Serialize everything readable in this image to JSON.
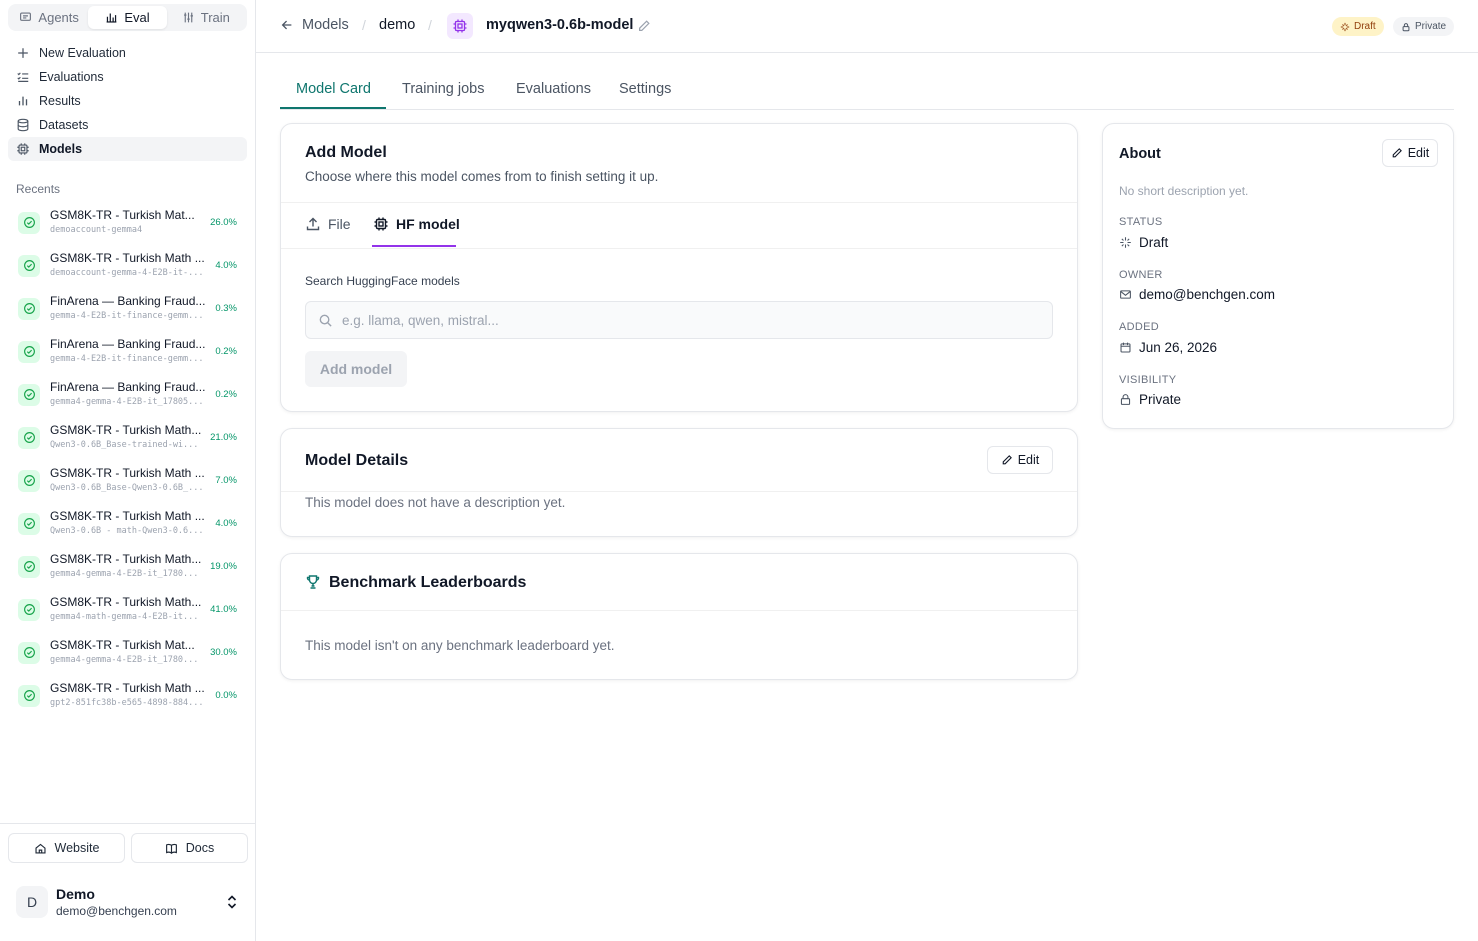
{
  "sidebar": {
    "modes": [
      {
        "label": "Agents",
        "icon": "chat-icon"
      },
      {
        "label": "Eval",
        "icon": "chart-icon"
      },
      {
        "label": "Train",
        "icon": "sliders-icon"
      }
    ],
    "nav": [
      {
        "label": "New Evaluation",
        "icon": "plus-icon"
      },
      {
        "label": "Evaluations",
        "icon": "list-check-icon"
      },
      {
        "label": "Results",
        "icon": "bar-chart-icon"
      },
      {
        "label": "Datasets",
        "icon": "database-icon"
      },
      {
        "label": "Models",
        "icon": "cpu-icon"
      }
    ],
    "recents_title": "Recents",
    "recents": [
      {
        "title": "GSM8K-TR - Turkish Mat...",
        "subtitle": "demoaccount-gemma4",
        "score": "26.0%"
      },
      {
        "title": "GSM8K-TR - Turkish Math ...",
        "subtitle": "demoaccount-gemma-4-E2B-it-...",
        "score": "4.0%"
      },
      {
        "title": "FinArena — Banking Fraud...",
        "subtitle": "gemma-4-E2B-it-finance-gemm...",
        "score": "0.3%"
      },
      {
        "title": "FinArena — Banking Fraud...",
        "subtitle": "gemma-4-E2B-it-finance-gemm...",
        "score": "0.2%"
      },
      {
        "title": "FinArena — Banking Fraud...",
        "subtitle": "gemma4-gemma-4-E2B-it_17805...",
        "score": "0.2%"
      },
      {
        "title": "GSM8K-TR - Turkish Math...",
        "subtitle": "Qwen3-0.6B_Base-trained-wi...",
        "score": "21.0%"
      },
      {
        "title": "GSM8K-TR - Turkish Math ...",
        "subtitle": "Qwen3-0.6B_Base-Qwen3-0.6B_...",
        "score": "7.0%"
      },
      {
        "title": "GSM8K-TR - Turkish Math ...",
        "subtitle": "Qwen3-0.6B - math-Qwen3-0.6...",
        "score": "4.0%"
      },
      {
        "title": "GSM8K-TR - Turkish Math...",
        "subtitle": "gemma4-gemma-4-E2B-it_1780...",
        "score": "19.0%"
      },
      {
        "title": "GSM8K-TR - Turkish Math...",
        "subtitle": "gemma4-math-gemma-4-E2B-it...",
        "score": "41.0%"
      },
      {
        "title": "GSM8K-TR - Turkish Mat...",
        "subtitle": "gemma4-gemma-4-E2B-it_1780...",
        "score": "30.0%"
      },
      {
        "title": "GSM8K-TR - Turkish Math ...",
        "subtitle": "gpt2-851fc38b-e565-4898-884...",
        "score": "0.0%"
      }
    ],
    "website_label": "Website",
    "docs_label": "Docs",
    "user": {
      "initial": "D",
      "name": "Demo",
      "email": "demo@benchgen.com"
    }
  },
  "header": {
    "back_label": "Models",
    "crumb_project": "demo",
    "model_name": "myqwen3-0.6b-model",
    "badge_draft": "Draft",
    "badge_private": "Private"
  },
  "tabs": [
    "Model Card",
    "Training jobs",
    "Evaluations",
    "Settings"
  ],
  "add_model": {
    "title": "Add Model",
    "subtitle": "Choose where this model comes from to finish setting it up.",
    "source_file": "File",
    "source_hf": "HF model",
    "search_label": "Search HuggingFace models",
    "search_placeholder": "e.g. llama, qwen, mistral...",
    "add_button": "Add model"
  },
  "model_details": {
    "title": "Model Details",
    "edit_label": "Edit",
    "empty": "This model does not have a description yet."
  },
  "leaderboards": {
    "title": "Benchmark Leaderboards",
    "empty": "This model isn't on any benchmark leaderboard yet."
  },
  "about": {
    "title": "About",
    "edit_label": "Edit",
    "description": "No short description yet.",
    "status_key": "STATUS",
    "status_val": "Draft",
    "owner_key": "OWNER",
    "owner_val": "demo@benchgen.com",
    "added_key": "ADDED",
    "added_val": "Jun 26, 2026",
    "visibility_key": "VISIBILITY",
    "visibility_val": "Private"
  },
  "colors": {
    "accent": "#0f766e",
    "hf_underline": "#9333ea",
    "success": "#059669",
    "draft_bg": "#fef3c7"
  }
}
